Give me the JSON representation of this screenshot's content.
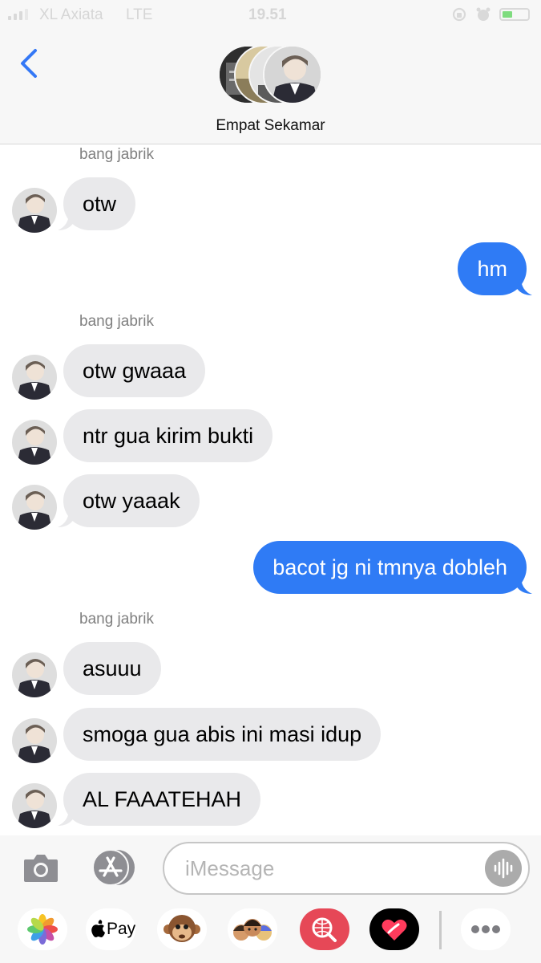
{
  "status_bar": {
    "carrier": "XL Axiata",
    "network": "LTE",
    "time": "19.51"
  },
  "header": {
    "group_name": "Empat Sekamar",
    "icon": "chevron-left-icon"
  },
  "messages": [
    {
      "sender": "bang jabrik"
    },
    {
      "text": "otw",
      "direction": "incoming"
    },
    {
      "text": "hm",
      "direction": "outgoing"
    },
    {
      "sender": "bang jabrik"
    },
    {
      "text": "otw gwaaa",
      "direction": "incoming"
    },
    {
      "text": "ntr gua kirim bukti",
      "direction": "incoming"
    },
    {
      "text": "otw yaaak",
      "direction": "incoming"
    },
    {
      "text": "bacot jg ni tmnya dobleh",
      "direction": "outgoing"
    },
    {
      "sender": "bang jabrik"
    },
    {
      "text": "asuuu",
      "direction": "incoming"
    },
    {
      "text": "smoga gua abis ini masi idup",
      "direction": "incoming"
    },
    {
      "text": "AL FAAATEHAH",
      "direction": "incoming"
    }
  ],
  "input": {
    "placeholder": "iMessage"
  },
  "app_drawer": {
    "apple_pay": "Pay",
    "apps": [
      "photos-icon",
      "apple-pay-icon",
      "memoji-monkey-icon",
      "memoji-icon",
      "web-search-icon",
      "digital-touch-icon",
      "more-icon"
    ]
  },
  "colors": {
    "outgoing_bubble": "#2f7bf5",
    "incoming_bubble": "#e9e9eb",
    "accent": "#3478f6"
  }
}
